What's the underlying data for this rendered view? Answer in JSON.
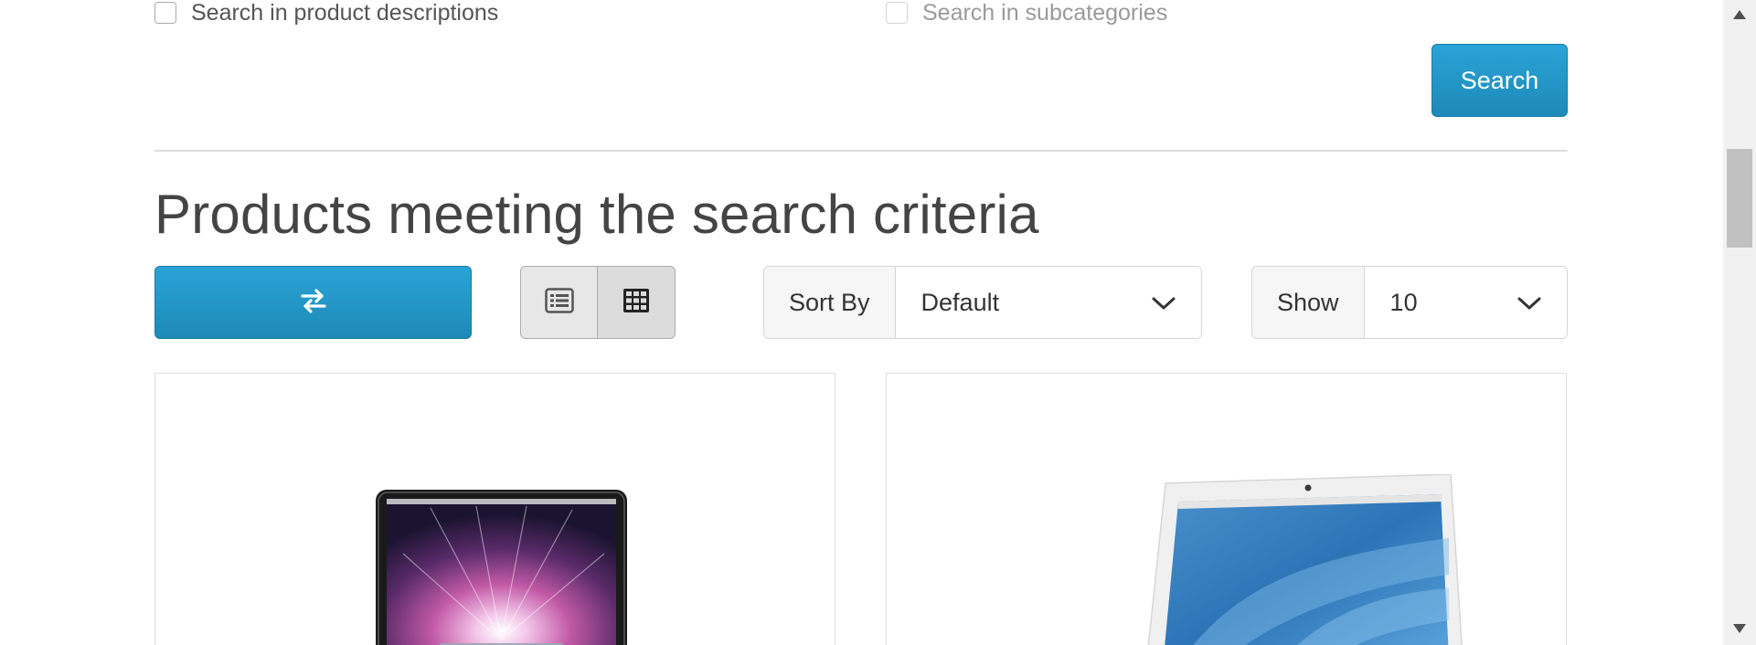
{
  "filters": {
    "search_descriptions_label": "Search in product descriptions",
    "search_subcategories_label": "Search in subcategories",
    "search_button_label": "Search"
  },
  "results": {
    "title": "Products meeting the search criteria",
    "compare_icon": "exchange-arrows-icon",
    "view_icons": [
      "list-view-icon",
      "grid-view-icon"
    ],
    "active_view": "grid",
    "sort": {
      "label": "Sort By",
      "value": "Default"
    },
    "show": {
      "label": "Show",
      "value": "10"
    }
  },
  "products": [
    {
      "image": "macbook-pro-thumbnail"
    },
    {
      "image": "macbook-thumbnail"
    }
  ],
  "colors": {
    "primary": "#229ac8",
    "text": "#444444",
    "border": "#dddddd"
  }
}
